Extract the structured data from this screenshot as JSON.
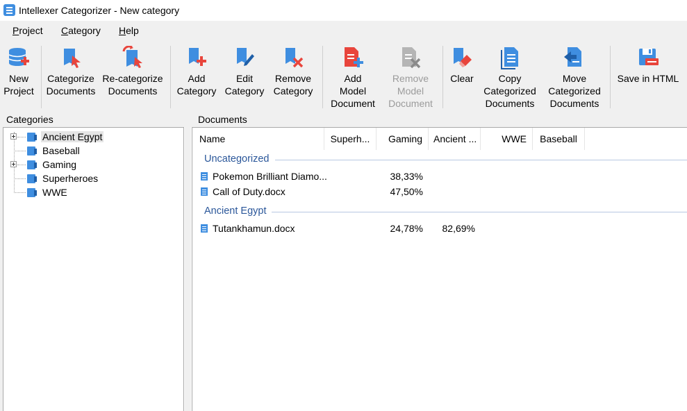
{
  "window": {
    "title": "Intellexer Categorizer - New category"
  },
  "menu": [
    {
      "label_u": "P",
      "label_rest": "roject"
    },
    {
      "label_u": "C",
      "label_rest": "ategory"
    },
    {
      "label_u": "H",
      "label_rest": "elp"
    }
  ],
  "toolbar": {
    "new_project": "New\nProject",
    "categorize": "Categorize\nDocuments",
    "recategorize": "Re-categorize\nDocuments",
    "add_category": "Add\nCategory",
    "edit_category": "Edit\nCategory",
    "remove_category": "Remove\nCategory",
    "add_model": "Add\nModel\nDocument",
    "remove_model": "Remove\nModel\nDocument",
    "clear": "Clear",
    "copy_categorized": "Copy\nCategorized\nDocuments",
    "move_categorized": "Move\nCategorized\nDocuments",
    "save_html": "Save in HTML"
  },
  "categories_panel": {
    "header": "Categories",
    "items": [
      {
        "label": "Ancient Egypt",
        "expandable": true,
        "selected": true
      },
      {
        "label": "Baseball",
        "expandable": false,
        "selected": false
      },
      {
        "label": "Gaming",
        "expandable": true,
        "selected": false
      },
      {
        "label": "Superheroes",
        "expandable": false,
        "selected": false
      },
      {
        "label": "WWE",
        "expandable": false,
        "selected": false
      }
    ]
  },
  "documents_panel": {
    "header": "Documents",
    "columns": [
      "Name",
      "Superh...",
      "Gaming",
      "Ancient ...",
      "WWE",
      "Baseball"
    ],
    "groups": [
      {
        "title": "Uncategorized",
        "rows": [
          {
            "name": "Pokemon Brilliant Diamo...",
            "gaming": "38,33%",
            "ancient": ""
          },
          {
            "name": "Call of Duty.docx",
            "gaming": "47,50%",
            "ancient": ""
          }
        ]
      },
      {
        "title": "Ancient Egypt",
        "rows": [
          {
            "name": "Tutankhamun.docx",
            "gaming": "24,78%",
            "ancient": "82,69%"
          }
        ]
      }
    ]
  },
  "colors": {
    "accent": "#3f8ee0",
    "group_text": "#2b579a",
    "red_accent": "#e8453c",
    "disabled_text": "#9b9b9b"
  }
}
